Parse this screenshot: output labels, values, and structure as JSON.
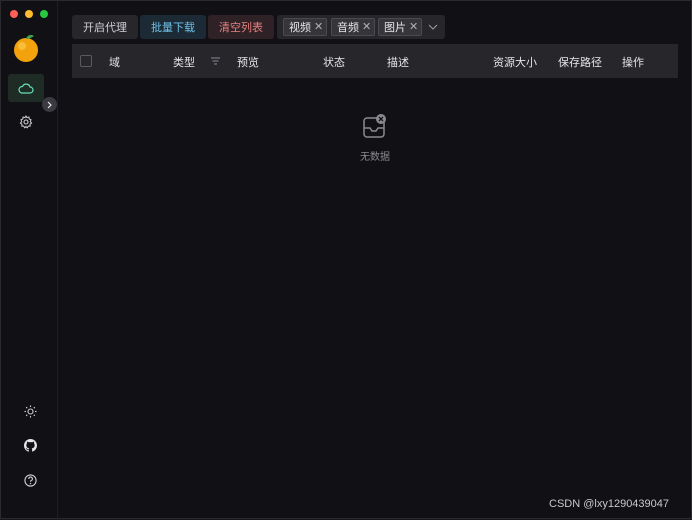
{
  "toolbar": {
    "proxy_label": "开启代理",
    "download_label": "批量下载",
    "clear_label": "清空列表"
  },
  "filter": {
    "tags": [
      "视频",
      "音频",
      "图片"
    ]
  },
  "table": {
    "columns": [
      "域",
      "类型",
      "预览",
      "状态",
      "描述",
      "资源大小",
      "保存路径",
      "操作"
    ],
    "empty_text": "无数据"
  },
  "sidebar": {
    "items": [
      "cloud-icon",
      "gear-icon"
    ],
    "bottom": [
      "sun-icon",
      "github-icon",
      "help-icon"
    ]
  },
  "watermark": "CSDN @lxy1290439047",
  "colors": {
    "accent_blue": "#70c0e8",
    "accent_red": "#e88080",
    "active_nav": "#63e2b7"
  }
}
